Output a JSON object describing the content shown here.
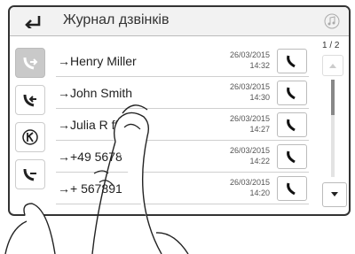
{
  "header": {
    "title": "Журнал дзвінків"
  },
  "calls": [
    {
      "name": "→Henry Miller",
      "date": "26/03/2015",
      "time": "14:32"
    },
    {
      "name": "→John Smith",
      "date": "26/03/2015",
      "time": "14:30"
    },
    {
      "name": "→Julia R      ff",
      "date": "26/03/2015",
      "time": "14:27"
    },
    {
      "name": "→+49      56789",
      "date": "26/03/2015",
      "time": "14:22"
    },
    {
      "name": "→+       567891",
      "date": "26/03/2015",
      "time": "14:20"
    }
  ],
  "pager": {
    "text": "1 / 2"
  },
  "icons": {
    "back": "back-arrow-icon",
    "music": "music-note-icon",
    "call": "phone-icon",
    "sidebar": [
      "outgoing-calls-icon",
      "incoming-calls-icon",
      "missed-calls-icon",
      "all-calls-icon"
    ]
  }
}
